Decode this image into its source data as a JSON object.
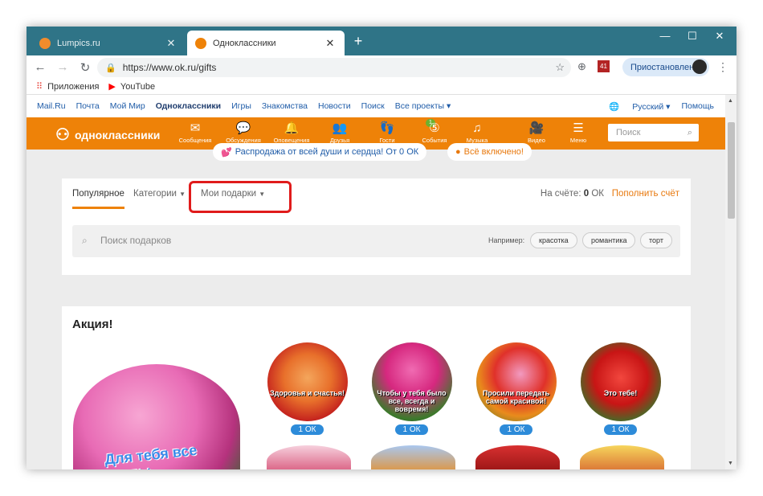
{
  "browser": {
    "tabs": [
      {
        "title": "Lumpics.ru",
        "favicon_color": "#f08c2c",
        "active": false
      },
      {
        "title": "Одноклассники",
        "favicon_color": "#ee8208",
        "active": true
      }
    ],
    "new_tab": "+",
    "url": "https://www.ok.ru/gifts",
    "profile_status": "Приостановлена",
    "ext_badge": "41"
  },
  "bookmarks": [
    {
      "label": "Приложения",
      "icon": "apps-grid-icon"
    },
    {
      "label": "YouTube",
      "icon": "youtube-icon"
    }
  ],
  "portal_links": [
    "Mail.Ru",
    "Почта",
    "Мой Мир",
    "Одноклассники",
    "Игры",
    "Знакомства",
    "Новости",
    "Поиск",
    "Все проекты ▾"
  ],
  "portal_right": {
    "language": "Русский ▾",
    "help": "Помощь"
  },
  "ok_header": {
    "logo": "одноклассники",
    "nav": [
      {
        "label": "Сообщения",
        "icon": "✉"
      },
      {
        "label": "Обсуждения",
        "icon": "💬"
      },
      {
        "label": "Оповещения",
        "icon": "🔔"
      },
      {
        "label": "Друзья",
        "icon": "👥"
      },
      {
        "label": "Гости",
        "icon": "👣"
      },
      {
        "label": "События",
        "icon": "⑤"
      },
      {
        "label": "Музыка",
        "icon": "♫"
      },
      {
        "label": "Видео",
        "icon": "🎥"
      },
      {
        "label": "Меню",
        "icon": "☰"
      }
    ],
    "guests_badge": "1",
    "search_placeholder": "Поиск"
  },
  "promos": {
    "sale": "Распродажа от всей души и сердца! От 0 ОК",
    "all_inclusive": "Всё включено!"
  },
  "gifts_tabs": {
    "popular": "Популярное",
    "categories": "Категории",
    "my_gifts": "Мои подарки",
    "balance_label": "На счёте:",
    "balance_value": "0",
    "balance_unit": "ОК",
    "top_up": "Пополнить счёт"
  },
  "gift_search": {
    "placeholder": "Поиск подарков",
    "example_label": "Например:",
    "chips": [
      "красотка",
      "романтика",
      "торт"
    ]
  },
  "promo_section": {
    "title": "Акция!",
    "big_gift_text": "Для тебя все цветы",
    "gifts": [
      {
        "caption": "Здоровья и счастья!",
        "price": "1 ОК"
      },
      {
        "caption": "Чтобы у тебя было все, всегда и вовремя!",
        "price": "1 ОК"
      },
      {
        "caption": "Просили передать самой красивой!",
        "price": "1 ОК"
      },
      {
        "caption": "Это тебе!",
        "price": "1 ОК"
      }
    ]
  },
  "colors": {
    "ok_orange": "#ee8208",
    "price_blue": "#2d8bd9",
    "highlight_red": "#e01b1b"
  }
}
